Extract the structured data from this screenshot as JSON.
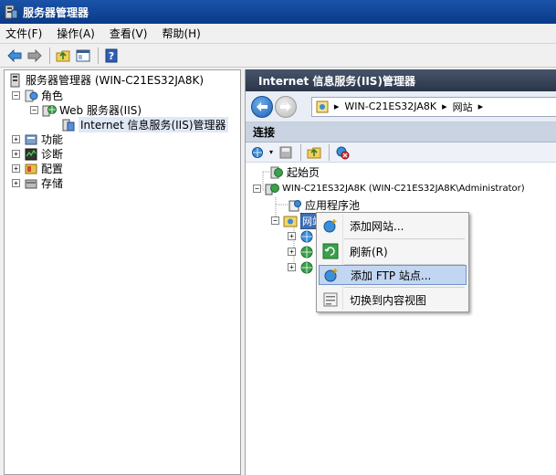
{
  "window": {
    "title": "服务器管理器"
  },
  "menu": {
    "items": [
      "文件(F)",
      "操作(A)",
      "查看(V)",
      "帮助(H)"
    ]
  },
  "left_tree": {
    "root": "服务器管理器 (WIN-C21ES32JA8K)",
    "roles": "角色",
    "web_server": "Web 服务器(IIS)",
    "iis_manager": "Internet 信息服务(IIS)管理器",
    "features": "功能",
    "diagnostics": "诊断",
    "configuration": "配置",
    "storage": "存储"
  },
  "right_pane": {
    "header": "Internet 信息服务(IIS)管理器",
    "address": {
      "machine": "WIN-C21ES32JA8K",
      "sites": "网站"
    },
    "connections_header": "连接",
    "tree": {
      "start_page": "起始页",
      "server": "WIN-C21ES32JA8K (WIN-C21ES32JA8K\\Administrator)",
      "app_pools": "应用程序池",
      "sites_selected": "网站"
    }
  },
  "context_menu": {
    "items": [
      "添加网站...",
      "刷新(R)",
      "添加 FTP 站点...",
      "切换到内容视图"
    ],
    "highlighted_index": 2
  },
  "colors": {
    "title_bar": "#0a3a88",
    "header": "#2a3548",
    "highlight": "#c2d6f2"
  }
}
